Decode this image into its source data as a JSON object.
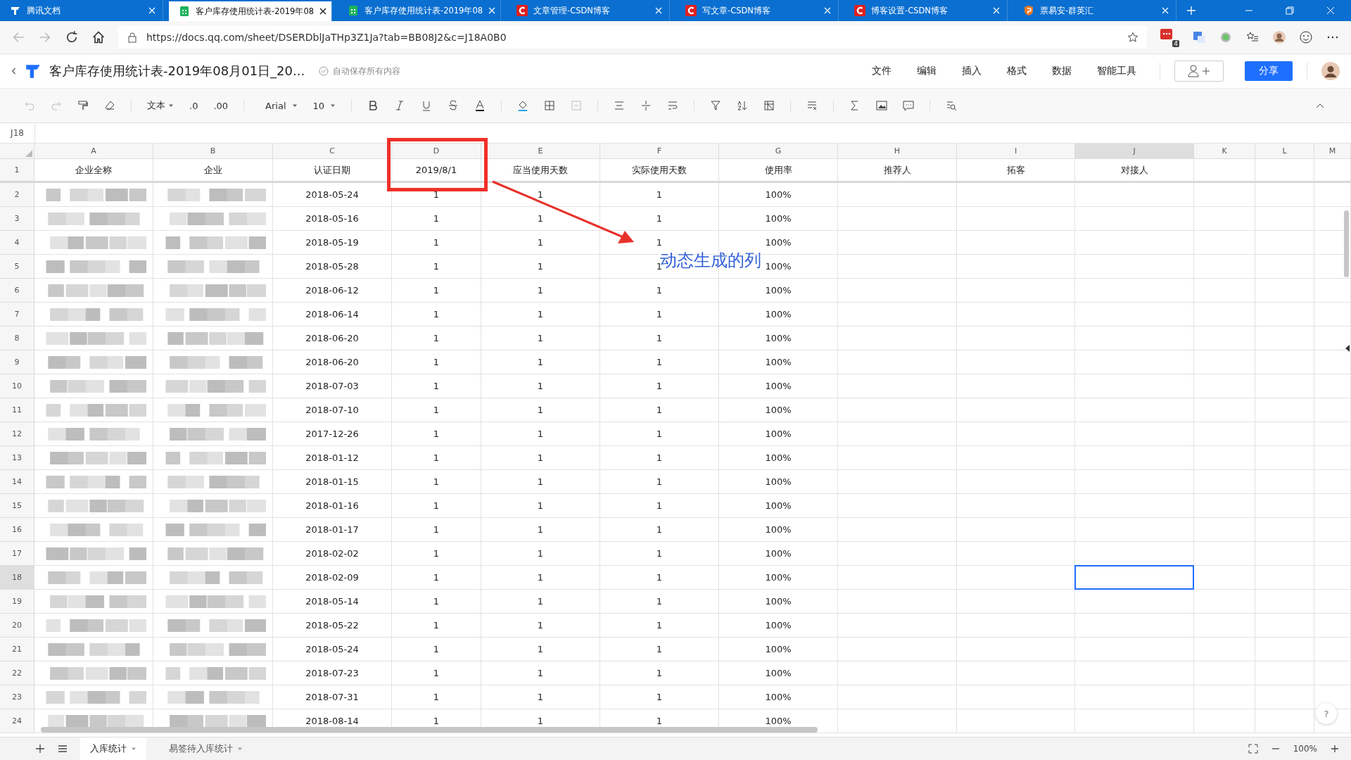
{
  "browser": {
    "tabs": [
      {
        "title": "腾讯文档",
        "kind": "tdocs",
        "selected": false
      },
      {
        "title": "客户库存使用统计表-2019年08",
        "kind": "sheet",
        "selected": true
      },
      {
        "title": "客户库存使用统计表-2019年08",
        "kind": "sheet",
        "selected": false
      },
      {
        "title": "文章管理-CSDN博客",
        "kind": "csdn",
        "selected": false
      },
      {
        "title": "写文章-CSDN博客",
        "kind": "csdn",
        "selected": false
      },
      {
        "title": "博客设置-CSDN博客",
        "kind": "csdn",
        "selected": false
      },
      {
        "title": "票易安-群英汇",
        "kind": "shield",
        "selected": false
      }
    ],
    "url": "https://docs.qq.com/sheet/DSERDblJaTHp3Z1Ja?tab=BB08J2&c=J18A0B0",
    "extension_badge": "4"
  },
  "doc": {
    "title": "客户库存使用统计表-2019年08月01日_20...",
    "save_status": "自动保存所有内容",
    "menu": [
      "文件",
      "编辑",
      "插入",
      "格式",
      "数据",
      "智能工具"
    ],
    "share": "分享"
  },
  "toolbar": {
    "text_format": "文本",
    "decrease_decimal": ".0",
    "increase_decimal": ".00",
    "font": "Arial",
    "size": "10"
  },
  "name_box": "J18",
  "sheet": {
    "columns": [
      {
        "letter": "A",
        "selected": false
      },
      {
        "letter": "B",
        "selected": false
      },
      {
        "letter": "C",
        "selected": false
      },
      {
        "letter": "D",
        "selected": false
      },
      {
        "letter": "E",
        "selected": false
      },
      {
        "letter": "F",
        "selected": false
      },
      {
        "letter": "G",
        "selected": false
      },
      {
        "letter": "H",
        "selected": false
      },
      {
        "letter": "I",
        "selected": false
      },
      {
        "letter": "J",
        "selected": true
      },
      {
        "letter": "K",
        "selected": false
      },
      {
        "letter": "L",
        "selected": false
      },
      {
        "letter": "M",
        "selected": false
      }
    ],
    "header_row": {
      "number": "1",
      "cells": [
        "企业全称",
        "企业",
        "认证日期",
        "2019/8/1",
        "应当使用天数",
        "实际使用天数",
        "使用率",
        "推荐人",
        "拓客",
        "对接人"
      ]
    },
    "rows": [
      {
        "number": "2",
        "cells": [
          "",
          "",
          "2018-05-24",
          "1",
          "1",
          "1",
          "100%"
        ],
        "selected": false
      },
      {
        "number": "3",
        "cells": [
          "",
          "",
          "2018-05-16",
          "1",
          "1",
          "1",
          "100%"
        ],
        "selected": false
      },
      {
        "number": "4",
        "cells": [
          "",
          "",
          "2018-05-19",
          "1",
          "1",
          "1",
          "100%"
        ],
        "selected": false
      },
      {
        "number": "5",
        "cells": [
          "",
          "",
          "2018-05-28",
          "1",
          "1",
          "1",
          "100%"
        ],
        "selected": false
      },
      {
        "number": "6",
        "cells": [
          "",
          "",
          "2018-06-12",
          "1",
          "1",
          "1",
          "100%"
        ],
        "selected": false
      },
      {
        "number": "7",
        "cells": [
          "",
          "",
          "2018-06-14",
          "1",
          "1",
          "1",
          "100%"
        ],
        "selected": false
      },
      {
        "number": "8",
        "cells": [
          "",
          "",
          "2018-06-20",
          "1",
          "1",
          "1",
          "100%"
        ],
        "selected": false
      },
      {
        "number": "9",
        "cells": [
          "",
          "",
          "2018-06-20",
          "1",
          "1",
          "1",
          "100%"
        ],
        "selected": false
      },
      {
        "number": "10",
        "cells": [
          "",
          "",
          "2018-07-03",
          "1",
          "1",
          "1",
          "100%"
        ],
        "selected": false
      },
      {
        "number": "11",
        "cells": [
          "",
          "",
          "2018-07-10",
          "1",
          "1",
          "1",
          "100%"
        ],
        "selected": false
      },
      {
        "number": "12",
        "cells": [
          "",
          "",
          "2017-12-26",
          "1",
          "1",
          "1",
          "100%"
        ],
        "selected": false
      },
      {
        "number": "13",
        "cells": [
          "",
          "",
          "2018-01-12",
          "1",
          "1",
          "1",
          "100%"
        ],
        "selected": false
      },
      {
        "number": "14",
        "cells": [
          "",
          "",
          "2018-01-15",
          "1",
          "1",
          "1",
          "100%"
        ],
        "selected": false
      },
      {
        "number": "15",
        "cells": [
          "",
          "",
          "2018-01-16",
          "1",
          "1",
          "1",
          "100%"
        ],
        "selected": false
      },
      {
        "number": "16",
        "cells": [
          "",
          "",
          "2018-01-17",
          "1",
          "1",
          "1",
          "100%"
        ],
        "selected": false
      },
      {
        "number": "17",
        "cells": [
          "",
          "",
          "2018-02-02",
          "1",
          "1",
          "1",
          "100%"
        ],
        "selected": false
      },
      {
        "number": "18",
        "cells": [
          "",
          "",
          "2018-02-09",
          "1",
          "1",
          "1",
          "100%"
        ],
        "selected": true
      },
      {
        "number": "19",
        "cells": [
          "",
          "",
          "2018-05-14",
          "1",
          "1",
          "1",
          "100%"
        ],
        "selected": false
      },
      {
        "number": "20",
        "cells": [
          "",
          "",
          "2018-05-22",
          "1",
          "1",
          "1",
          "100%"
        ],
        "selected": false
      },
      {
        "number": "21",
        "cells": [
          "",
          "",
          "2018-05-24",
          "1",
          "1",
          "1",
          "100%"
        ],
        "selected": false
      },
      {
        "number": "22",
        "cells": [
          "",
          "",
          "2018-07-23",
          "1",
          "1",
          "1",
          "100%"
        ],
        "selected": false
      },
      {
        "number": "23",
        "cells": [
          "",
          "",
          "2018-07-31",
          "1",
          "1",
          "1",
          "100%"
        ],
        "selected": false
      },
      {
        "number": "24",
        "cells": [
          "",
          "",
          "2018-08-14",
          "1",
          "1",
          "1",
          "100%"
        ],
        "selected": false
      }
    ]
  },
  "annotation": {
    "text": "动态生成的列"
  },
  "sheet_tabs": [
    {
      "label": "入库统计",
      "selected": true
    },
    {
      "label": "易签待入库统计",
      "selected": false
    }
  ],
  "zoom": "100%",
  "help": "?"
}
